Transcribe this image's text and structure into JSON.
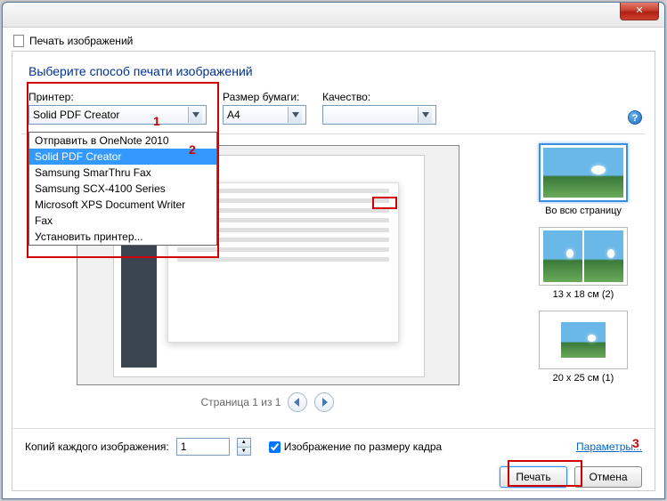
{
  "window": {
    "title": "Печать изображений"
  },
  "subtitle": "Выберите способ печати изображений",
  "controls": {
    "printer_label": "Принтер:",
    "printer_value": "Solid PDF Creator",
    "paper_label": "Размер бумаги:",
    "paper_value": "A4",
    "quality_label": "Качество:",
    "quality_value": ""
  },
  "dropdown_items": [
    "Отправить в OneNote 2010",
    "Solid PDF Creator",
    "Samsung SmarThru Fax",
    "Samsung SCX-4100 Series",
    "Microsoft XPS Document Writer",
    "Fax",
    "Установить принтер..."
  ],
  "dropdown_selected_index": 1,
  "pager": {
    "text": "Страница 1 из 1"
  },
  "layouts": [
    {
      "label": "Во всю страницу",
      "cols": 1,
      "selected": true
    },
    {
      "label": "13 x 18 см (2)",
      "cols": 2,
      "selected": false
    },
    {
      "label": "20 x 25 см (1)",
      "cols": 1,
      "small": true,
      "selected": false
    }
  ],
  "bottom": {
    "copies_label": "Копий каждого изображения:",
    "copies_value": "1",
    "fit_label": "Изображение по размеру кадра",
    "fit_checked": true,
    "params_link": "Параметры..."
  },
  "buttons": {
    "print": "Печать",
    "cancel": "Отмена"
  },
  "annotations": {
    "n1": "1",
    "n2": "2",
    "n3": "3"
  }
}
